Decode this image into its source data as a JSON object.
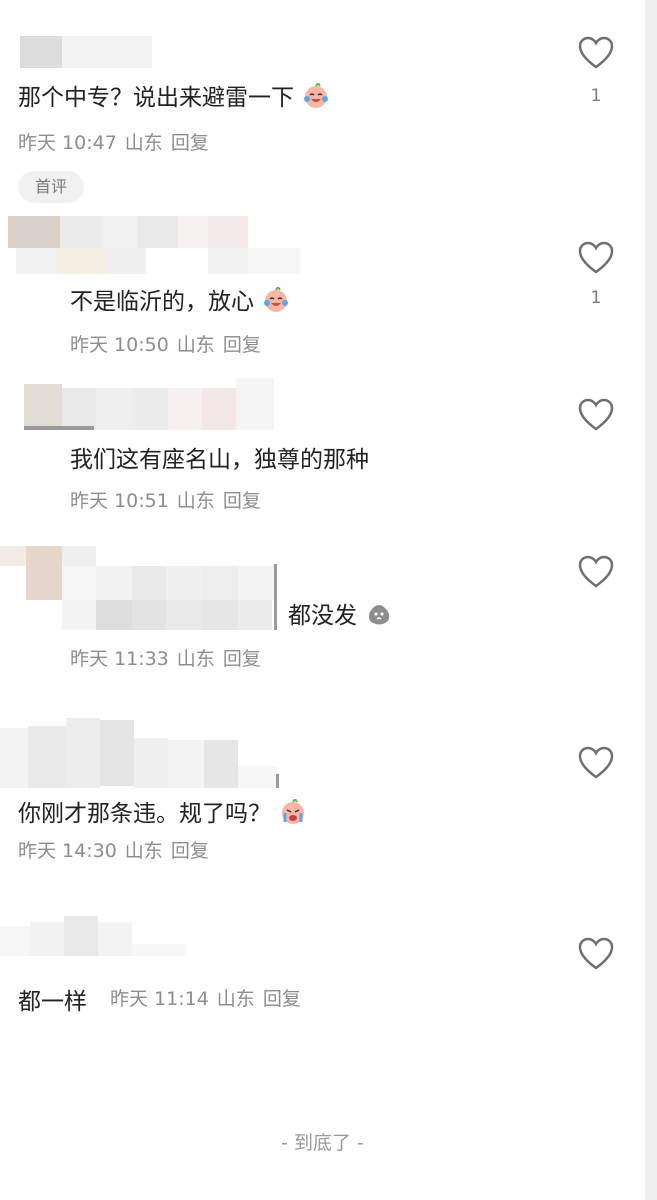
{
  "comments": [
    {
      "text": "那个中专？说出来避雷一下",
      "time": "昨天 10:47",
      "location": "山东",
      "reply": "回复",
      "likes": "1",
      "tag": "首评",
      "emoji": "crying-laugh-icon"
    },
    {
      "text": "不是临沂的，放心",
      "time": "昨天 10:50",
      "location": "山东",
      "reply": "回复",
      "likes": "1",
      "emoji": "crying-laugh-icon"
    },
    {
      "text": "我们这有座名山，独尊的那种",
      "time": "昨天 10:51",
      "location": "山东",
      "reply": "回复"
    },
    {
      "text": "都没发",
      "time": "昨天 11:33",
      "location": "山东",
      "reply": "回复",
      "emoji": "sweat-face-icon"
    },
    {
      "text": "你刚才那条违。规了吗？",
      "time": "昨天 14:30",
      "location": "山东",
      "reply": "回复",
      "emoji": "loud-crying-icon"
    },
    {
      "text": "都一样",
      "time": "昨天 11:14",
      "location": "山东",
      "reply": "回复"
    }
  ],
  "footer": "- 到底了 -",
  "colors": {
    "meta": "#8e8e8e",
    "heart": "#6f6f6f",
    "tag_bg": "#f1f1f1"
  }
}
